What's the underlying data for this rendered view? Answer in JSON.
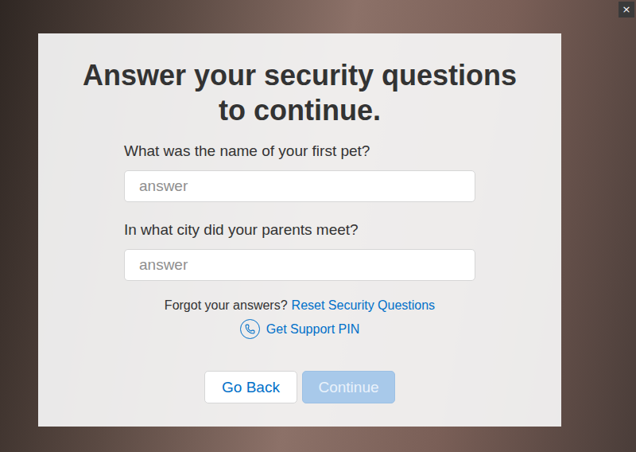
{
  "window": {
    "close": "×"
  },
  "title": "Answer your security questions to continue.",
  "questions": [
    {
      "label": "What was the name of your first pet?",
      "placeholder": "answer",
      "value": ""
    },
    {
      "label": "In what city did your parents meet?",
      "placeholder": "answer",
      "value": ""
    }
  ],
  "forgot": {
    "text": "Forgot your answers?",
    "link": "Reset Security Questions"
  },
  "support": {
    "link": "Get Support PIN"
  },
  "buttons": [
    {
      "label": "Go Back",
      "kind": "secondary",
      "disabled": false
    },
    {
      "label": "Continue",
      "kind": "primary",
      "disabled": true
    }
  ]
}
